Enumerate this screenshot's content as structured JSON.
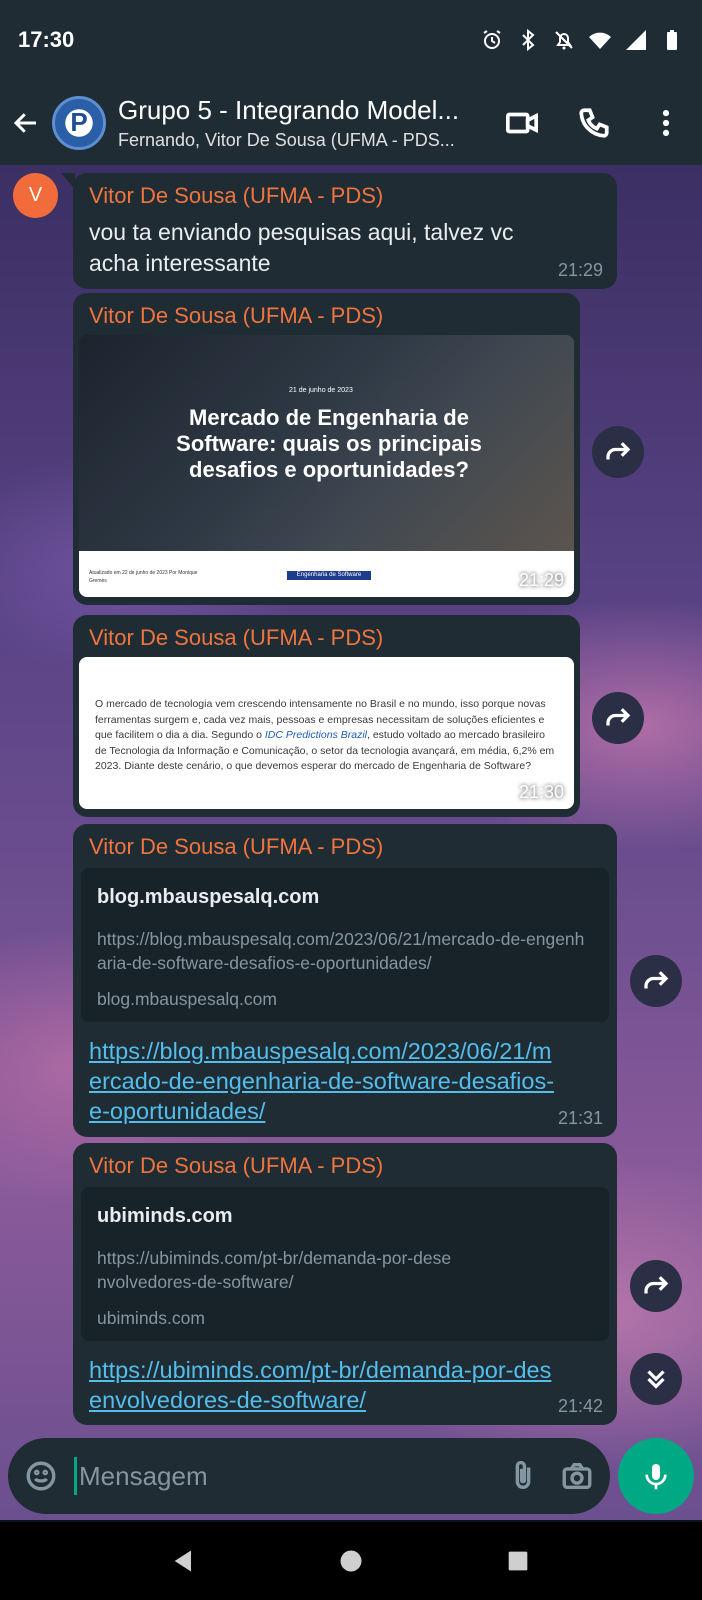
{
  "status_bar": {
    "time": "17:30"
  },
  "header": {
    "title": "Grupo 5 - Integrando Model...",
    "subtitle": "Fernando, Vitor De Sousa (UFMA - PDS..."
  },
  "avatar_initial": "V",
  "messages": [
    {
      "sender": "Vitor De Sousa (UFMA - PDS)",
      "text": "vou ta enviando pesquisas aqui, talvez vc acha interessante",
      "time": "21:29"
    },
    {
      "sender": "Vitor De Sousa (UFMA - PDS)",
      "image_headline": "Mercado de Engenharia de Software: quais os principais desafios e oportunidades?",
      "image_date": "21 de junho de 2023",
      "image_tag": "Engenharia de Software",
      "image_footer": "Atualizado em 22 de junho de 2023 Por Monique Gremes",
      "time": "21:29"
    },
    {
      "sender": "Vitor De Sousa (UFMA - PDS)",
      "image_text_before": "O mercado de tecnologia vem crescendo intensamente no Brasil e no mundo, isso porque novas ferramentas surgem e, cada vez mais, pessoas e empresas necessitam de soluções eficientes e que facilitem o dia a dia. Segundo o ",
      "image_text_highlight": "IDC Predictions Brazil",
      "image_text_after": ", estudo voltado ao mercado brasileiro de Tecnologia da Informação e Comunicação, o setor da tecnologia avançará, em média, 6,2% em 2023. Diante deste cenário, o que devemos esperar do mercado de Engenharia de Software?",
      "time": "21:30"
    },
    {
      "sender": "Vitor De Sousa (UFMA - PDS)",
      "preview_title": "blog.mbauspesalq.com",
      "preview_url": "https://blog.mbauspesalq.com/2023/06/21/mercado-de-engenharia-de-software-desafios-e-oportunidades/",
      "preview_domain": "blog.mbauspesalq.com",
      "link": "https://blog.mbauspesalq.com/2023/06/21/mercado-de-engenharia-de-software-desafios-e-oportunidades/",
      "time": "21:31"
    },
    {
      "sender": "Vitor De Sousa (UFMA - PDS)",
      "preview_title": "ubiminds.com",
      "preview_url": "https://ubiminds.com/pt-br/demanda-por-desenvolvedores-de-software/",
      "preview_domain": "ubiminds.com",
      "link": "https://ubiminds.com/pt-br/demanda-por-desenvolvedores-de-software/",
      "time": "21:42"
    }
  ],
  "composer": {
    "placeholder": "Mensagem"
  },
  "colors": {
    "sender": "#f0743e",
    "link": "#53bdeb",
    "accent": "#00a884",
    "bubble": "#1f2c34"
  }
}
